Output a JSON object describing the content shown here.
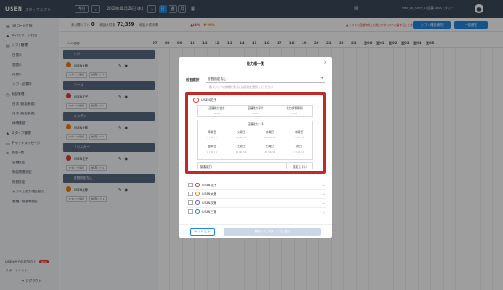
{
  "app": {
    "logo": "USEN",
    "logo_sub": "スタッフシフト"
  },
  "topbar": {
    "today_label": "今日",
    "prev_label": "‹",
    "next_label": "›",
    "date": "2023年01月26日 (木)",
    "views": [
      "日",
      "週",
      "月"
    ],
    "store": "TEST_DB_SHIFT_1の店舗 URSS スタッフ",
    "avatar_initial": "●"
  },
  "sidebar": {
    "items": [
      {
        "icon": "qr-icon",
        "glyph": "▦",
        "label": "QRコード打刻"
      },
      {
        "icon": "person-icon",
        "glyph": "♟",
        "label": "IDパスワード打刻"
      },
      {
        "icon": "calendar-icon",
        "glyph": "▤",
        "label": "シフト管理"
      },
      {
        "icon": "",
        "glyph": "",
        "label": "日表示",
        "sub": true
      },
      {
        "icon": "",
        "glyph": "",
        "label": "週表示",
        "sub": true
      },
      {
        "icon": "",
        "glyph": "",
        "label": "月表示",
        "sub": true
      },
      {
        "icon": "",
        "glyph": "",
        "label": "シフト必要枠",
        "sub": true
      },
      {
        "icon": "clock-icon",
        "glyph": "◷",
        "label": "勤怠管理"
      },
      {
        "icon": "",
        "glyph": "",
        "label": "日次 (勤怠承認)",
        "sub": true
      },
      {
        "icon": "",
        "glyph": "",
        "label": "月次 (勤怠承認)",
        "sub": true
      },
      {
        "icon": "",
        "glyph": "",
        "label": "休暇確認",
        "sub": true
      },
      {
        "icon": "people-icon",
        "glyph": "♞",
        "label": "スタッフ管理"
      },
      {
        "icon": "chat-icon",
        "glyph": "▭",
        "label": "チャットメッセージ"
      },
      {
        "icon": "gear-icon",
        "glyph": "✲",
        "label": "設定一覧"
      },
      {
        "icon": "",
        "glyph": "",
        "label": "店舗設定",
        "sub": true
      },
      {
        "icon": "",
        "glyph": "",
        "label": "勤怠関連設定",
        "sub": true
      },
      {
        "icon": "",
        "glyph": "",
        "label": "役割設定",
        "sub": true
      },
      {
        "icon": "",
        "glyph": "",
        "label": "カスタム能力項目設定",
        "sub": true
      },
      {
        "icon": "",
        "glyph": "",
        "label": "業種・規模等設定",
        "sub": true
      }
    ],
    "notice": "USENからのお知らせ",
    "notice_badge": "NEW",
    "support": "サポートサイト",
    "logout": "ログアウト"
  },
  "subbar": {
    "shift_label": "未公開シフト",
    "shift_count": "0",
    "labor_label": "総延人件費",
    "labor_value": "72,359",
    "ratio_label": "総延人件費率",
    "ratio_a": "▲14%",
    "ratio_b": "▼-20%",
    "alert": "▲ シフトを自動作成した後にスタッフへ公開することをご確認ください",
    "notify_button": "シフト確定通知",
    "bulk_button": "一括確定"
  },
  "grid": {
    "hours": [
      "07",
      "08",
      "09",
      "10",
      "11",
      "12",
      "13",
      "14",
      "15",
      "16",
      "17",
      "18",
      "19",
      "20",
      "21",
      "22",
      "23",
      "翌00",
      "翌01",
      "翌02",
      "翌03",
      "翌04",
      "翌05"
    ],
    "count_label": "人の確認",
    "groups": [
      {
        "name": "レジ",
        "staff": "USEN太郎",
        "color": "#f57c00"
      },
      {
        "name": "ホール",
        "staff": "USEN花子",
        "color": "#e53935"
      },
      {
        "name": "キッチン",
        "staff": "USEN太郎",
        "color": "#f57c00"
      },
      {
        "name": "ドリンカー",
        "staff": "USEN花子",
        "color": "#e53935"
      },
      {
        "name": "役割指定なし",
        "staff": "USEN太郎",
        "color": "#f57c00"
      }
    ],
    "add_staff": "スタッフ追加",
    "copy_shift": "前週シフト"
  },
  "modal": {
    "title": "能力値一覧",
    "close": "×",
    "role_label": "役割選択",
    "role_value": "役割指定なし",
    "hint": "各スタッフの詳細を見るには名前を選択してください",
    "card": {
      "name": "USEN花子",
      "top_headers": [
        "店舗能力合計",
        "店舗能力平均",
        "能力評価時間"
      ],
      "top_values": [
        "0 / 0",
        "0 / 0",
        "0 / 0"
      ],
      "mid_title": "店舗能力・率",
      "mid_headers": [
        "月曜日",
        "火曜日",
        "水曜日",
        "木曜日",
        "金曜日",
        "土曜日",
        "日曜日",
        "祝日"
      ],
      "mid_values": [
        "0 / 0 / 0",
        "0 / 0 / 0",
        "0 / 0 / 0",
        "0 / 0 / 0",
        "0 / 0 / 0",
        "0 / 0 / 0",
        "0 / 0 / 0",
        "0 / 0 / 0"
      ],
      "last_label": "接客能力",
      "last_value": "設定しない"
    },
    "list": [
      {
        "name": "USEN花子",
        "color": "#e53935"
      },
      {
        "name": "USEN太郎",
        "color": "#f57c00"
      },
      {
        "name": "USEN次郎",
        "color": "#7b61c4"
      },
      {
        "name": "USEN三郎",
        "color": "#1e88e5"
      }
    ],
    "cancel": "キャンセル",
    "submit": "選択したスタッフを追加"
  }
}
